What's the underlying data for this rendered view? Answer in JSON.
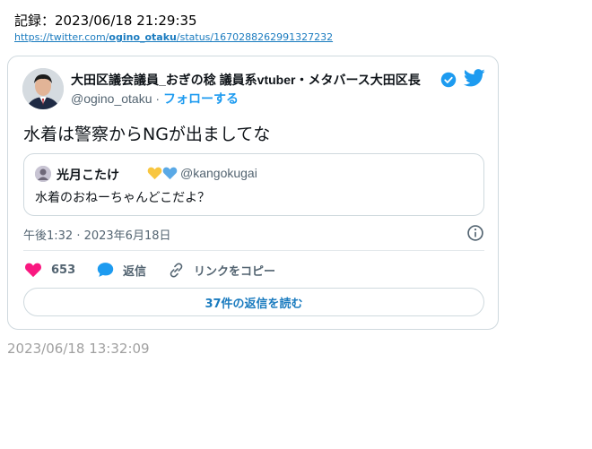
{
  "header": {
    "record_label": "記録：2023/06/18 21:29:35",
    "link_prefix": "https://twitter.com/",
    "link_user": "ogino_otaku",
    "link_suffix": "/status/1670288262991327232"
  },
  "tweet": {
    "display_name": "大田区議会議員_おぎの稔 議員系vtuber・メタバース大田区長",
    "handle": "@ogino_otaku",
    "separator": " · ",
    "follow_label": "フォローする",
    "text": "水着は警察からNGが出ましてな",
    "quote": {
      "name": "光月こたけ",
      "handle": "@kangokugai",
      "text": "水着のおねーちゃんどこだよ？"
    },
    "timestamp": "午後1:32 · 2023年6月18日",
    "actions": {
      "like_count": "653",
      "reply_label": "返信",
      "copy_label": "リンクをコピー"
    },
    "read_replies_label": "37件の返信を読む"
  },
  "footer": {
    "saved_time": "2023/06/18 13:32:09"
  },
  "icons": {
    "verified": "verified-badge-icon",
    "twitter": "twitter-bird-icon",
    "heart": "heart-icon",
    "reply": "reply-bubble-icon",
    "link": "link-icon",
    "info": "info-icon"
  },
  "colors": {
    "accent": "#1d9bf0",
    "like": "#f91880",
    "link": "#1a7bbf",
    "muted": "#536471",
    "heart_yellow": "#f8c640",
    "heart_blue": "#5aa9e6"
  }
}
